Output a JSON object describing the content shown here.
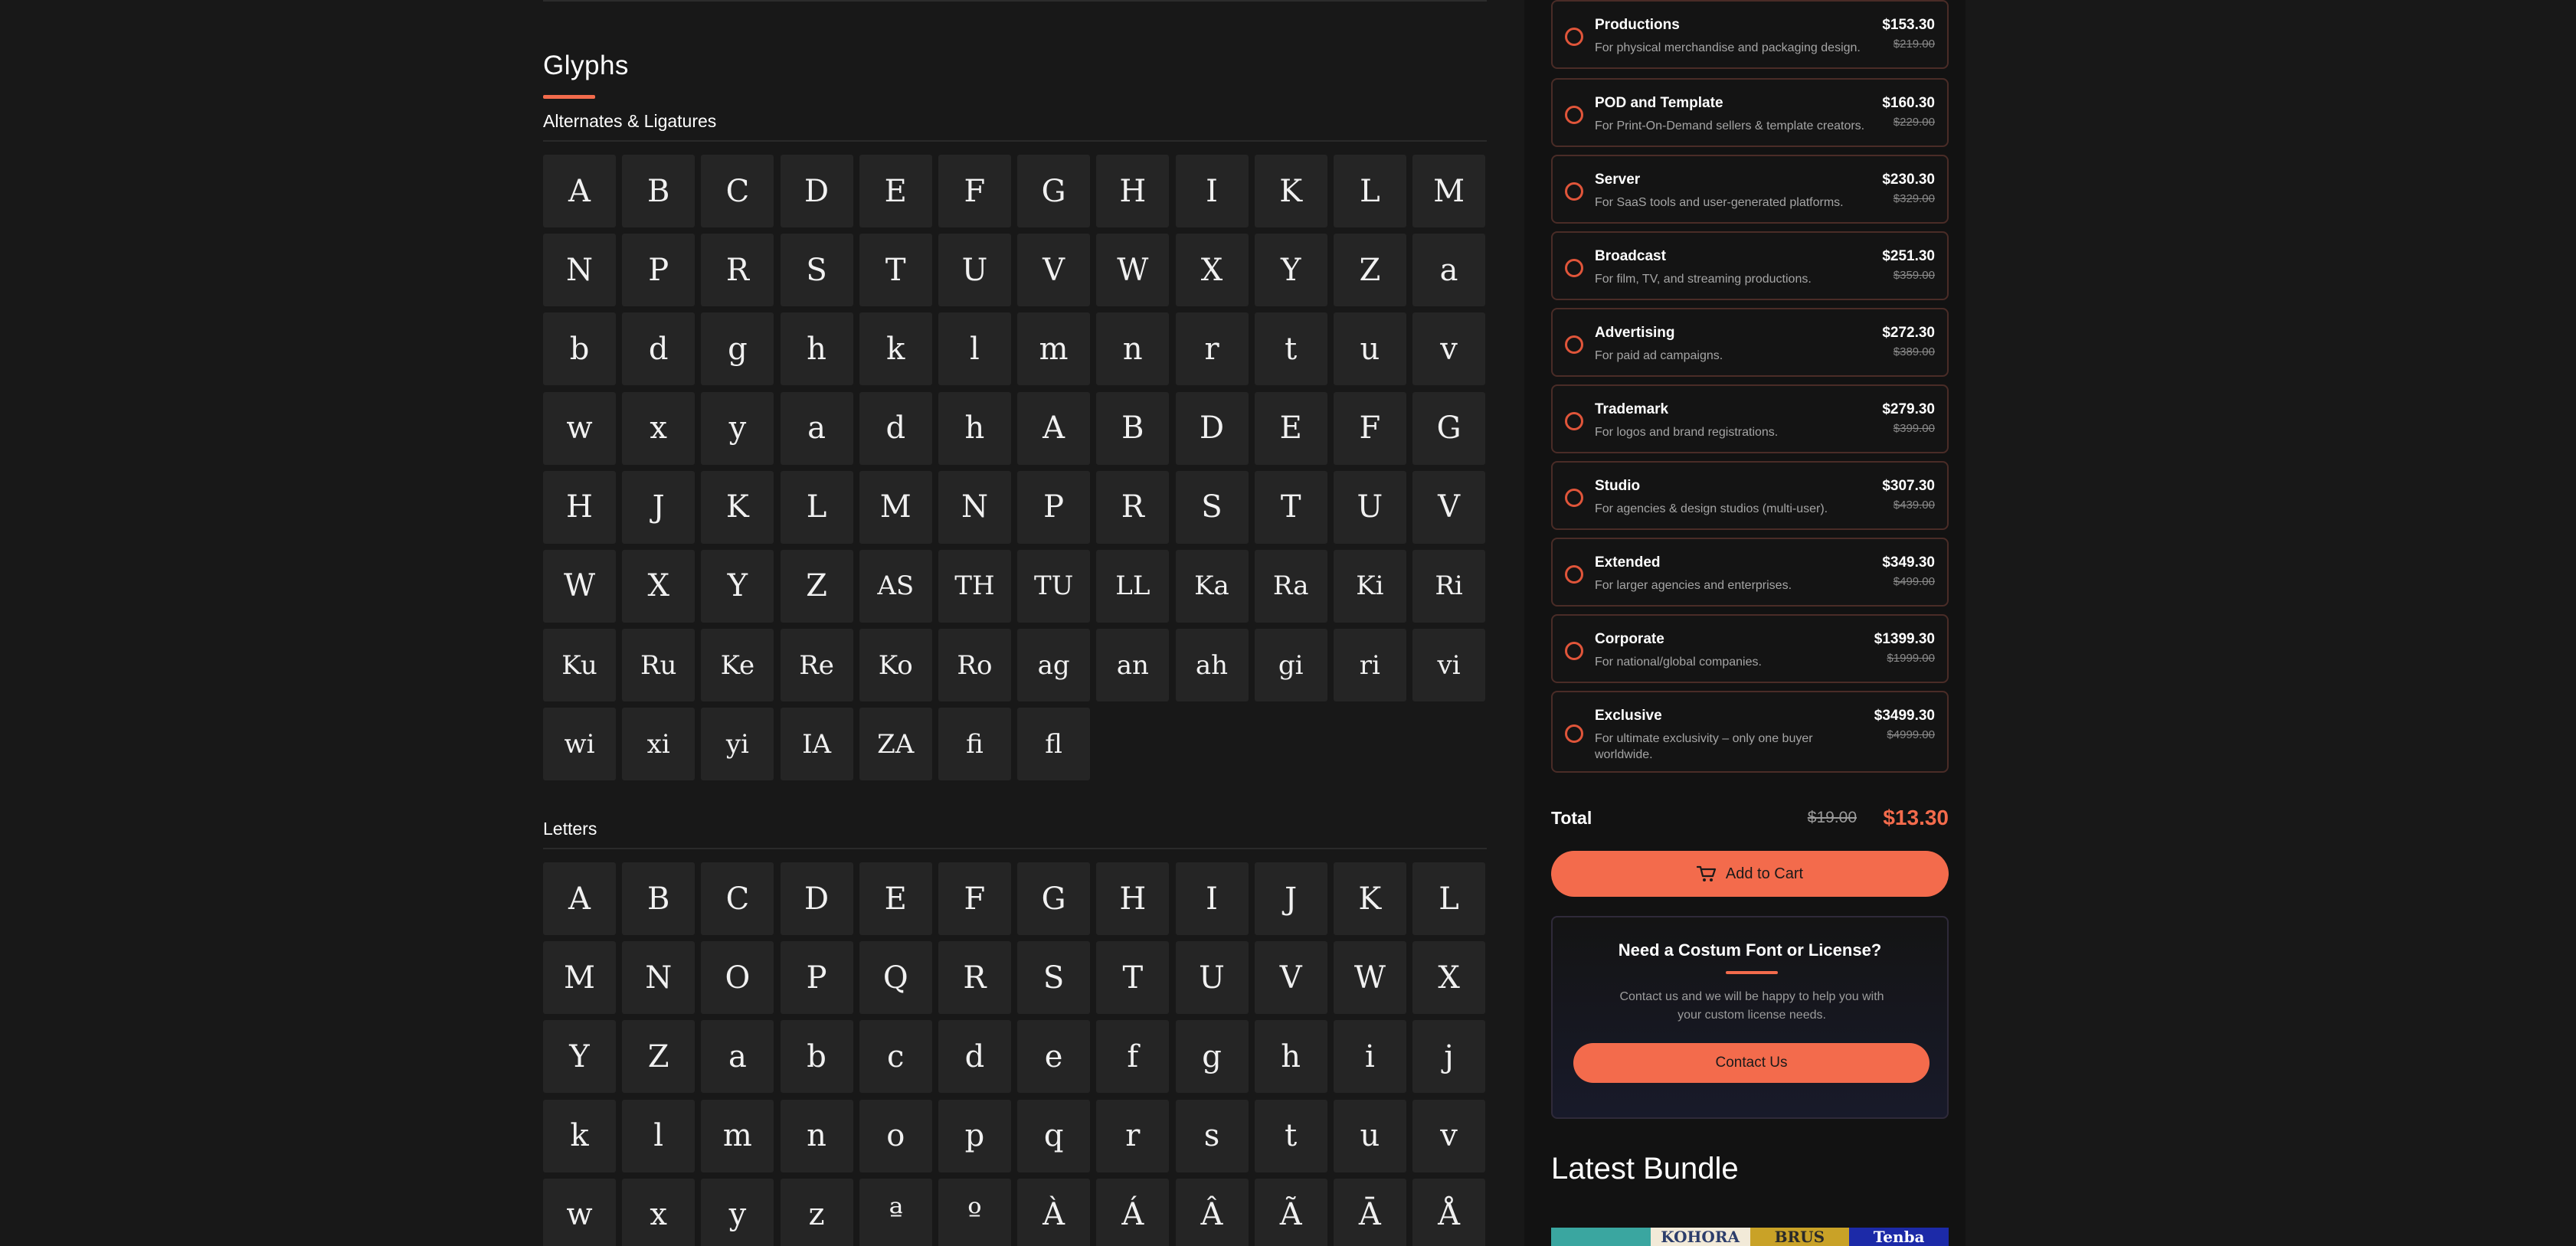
{
  "glyphs": {
    "title": "Glyphs",
    "alternates_heading": "Alternates & Ligatures",
    "alternates": [
      "A",
      "B",
      "C",
      "D",
      "E",
      "F",
      "G",
      "H",
      "I",
      "K",
      "L",
      "M",
      "N",
      "P",
      "R",
      "S",
      "T",
      "U",
      "V",
      "W",
      "X",
      "Y",
      "Z",
      "a",
      "b",
      "d",
      "g",
      "h",
      "k",
      "l",
      "m",
      "n",
      "r",
      "t",
      "u",
      "v",
      "w",
      "x",
      "y",
      "a",
      "d",
      "h",
      "A",
      "B",
      "D",
      "E",
      "F",
      "G",
      "H",
      "J",
      "K",
      "L",
      "M",
      "N",
      "P",
      "R",
      "S",
      "T",
      "U",
      "V",
      "W",
      "X",
      "Y",
      "Z",
      "AS",
      "TH",
      "TU",
      "LL",
      "Ka",
      "Ra",
      "Ki",
      "Ri",
      "Ku",
      "Ru",
      "Ke",
      "Re",
      "Ko",
      "Ro",
      "ag",
      "an",
      "ah",
      "gi",
      "ri",
      "vi",
      "wi",
      "xi",
      "yi",
      "IA",
      "ZA",
      "fi",
      "fl"
    ],
    "letters_heading": "Letters",
    "letters": [
      "A",
      "B",
      "C",
      "D",
      "E",
      "F",
      "G",
      "H",
      "I",
      "J",
      "K",
      "L",
      "M",
      "N",
      "O",
      "P",
      "Q",
      "R",
      "S",
      "T",
      "U",
      "V",
      "W",
      "X",
      "Y",
      "Z",
      "a",
      "b",
      "c",
      "d",
      "e",
      "f",
      "g",
      "h",
      "i",
      "j",
      "k",
      "l",
      "m",
      "n",
      "o",
      "p",
      "q",
      "r",
      "s",
      "t",
      "u",
      "v",
      "w",
      "x",
      "y",
      "z",
      "ª",
      "º",
      "À",
      "Á",
      "Â",
      "Ã",
      "Ā",
      "Å"
    ]
  },
  "licenses": [
    {
      "name": "Productions",
      "desc": "For physical merchandise and packaging design.",
      "price": "$153.30",
      "old": "$219.00"
    },
    {
      "name": "POD and Template",
      "desc": "For Print-On-Demand sellers & template creators.",
      "price": "$160.30",
      "old": "$229.00"
    },
    {
      "name": "Server",
      "desc": "For SaaS tools and user-generated platforms.",
      "price": "$230.30",
      "old": "$329.00"
    },
    {
      "name": "Broadcast",
      "desc": "For film, TV, and streaming productions.",
      "price": "$251.30",
      "old": "$359.00"
    },
    {
      "name": "Advertising",
      "desc": "For paid ad campaigns.",
      "price": "$272.30",
      "old": "$389.00"
    },
    {
      "name": "Trademark",
      "desc": "For logos and brand registrations.",
      "price": "$279.30",
      "old": "$399.00"
    },
    {
      "name": "Studio",
      "desc": "For agencies & design studios (multi-user).",
      "price": "$307.30",
      "old": "$439.00"
    },
    {
      "name": "Extended",
      "desc": "For larger agencies and enterprises.",
      "price": "$349.30",
      "old": "$499.00"
    },
    {
      "name": "Corporate",
      "desc": "For national/global companies.",
      "price": "$1399.30",
      "old": "$1999.00"
    },
    {
      "name": "Exclusive",
      "desc": "For ultimate exclusivity – only one buyer worldwide.",
      "price": "$3499.30",
      "old": "$4999.00"
    }
  ],
  "total": {
    "label": "Total",
    "old": "$19.00",
    "new": "$13.30"
  },
  "cart": {
    "label": "Add to Cart",
    "icon": "cart-icon"
  },
  "help": {
    "title": "Need a Costum Font or License?",
    "text": "Contact us and we will be happy to help you with your custom license needs.",
    "button": "Contact Us"
  },
  "bundle": {
    "title": "Latest Bundle",
    "tiles": [
      {
        "text": "",
        "bg": "#3aa6a0",
        "fg": "#e94c3d"
      },
      {
        "text": "KOHORA",
        "bg": "#f2ead8",
        "fg": "#2c3d6b"
      },
      {
        "text": "BRUS",
        "bg": "#c9a227",
        "fg": "#2a2a2a"
      },
      {
        "text": "Tenba",
        "bg": "#1c2aa8",
        "fg": "#ffffff"
      }
    ]
  },
  "colors": {
    "accent": "#f36b4c",
    "panel_border": "#4a2c27",
    "cell": "#252525",
    "background": "#181818"
  }
}
